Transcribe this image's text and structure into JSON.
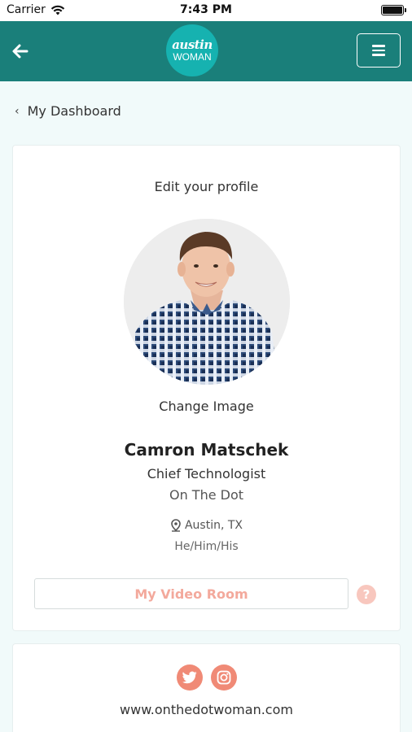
{
  "status_bar": {
    "carrier": "Carrier",
    "time": "7:43 PM"
  },
  "header": {
    "logo_top": "austin",
    "logo_bottom": "WOMAN",
    "background_color": "#1a7f7a",
    "logo_color": "#16b2b0"
  },
  "breadcrumb": {
    "label": "My Dashboard"
  },
  "profile": {
    "title": "Edit your profile",
    "change_image": "Change Image",
    "name": "Camron Matschek",
    "role": "Chief Technologist",
    "company": "On The Dot",
    "location": "Austin, TX",
    "pronouns": "He/Him/His",
    "video_room_label": "My Video Room",
    "help_label": "?"
  },
  "social": {
    "icons": [
      "twitter-icon",
      "instagram-icon"
    ],
    "accent_color": "#f08a76",
    "website": "www.onthedotwoman.com"
  }
}
